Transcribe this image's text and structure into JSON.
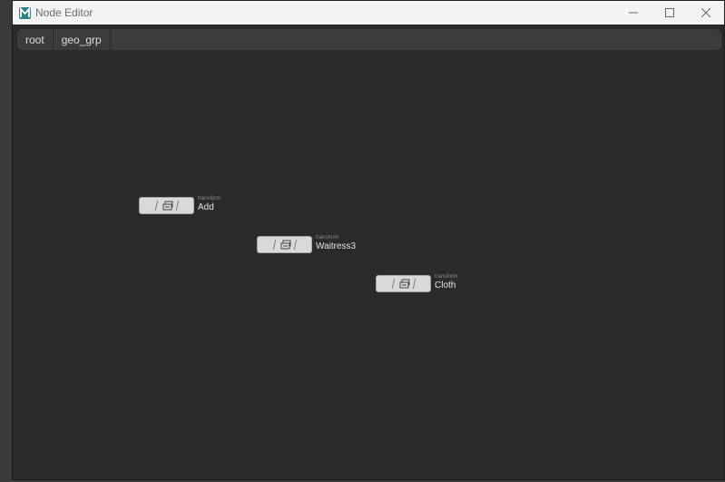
{
  "window": {
    "title": "Node Editor"
  },
  "window_controls": {
    "minimize": "—",
    "maximize": "☐",
    "close": "✕"
  },
  "breadcrumb": [
    "root",
    "geo_grp"
  ],
  "nodes": [
    {
      "type": "transform",
      "label": "Add"
    },
    {
      "type": "transform",
      "label": "Waitress3"
    },
    {
      "type": "transform",
      "label": "Cloth"
    }
  ],
  "colors": {
    "canvas": "#2b2b2b",
    "titlebar": "#f3f3f3",
    "logo_accent": "#2f7f86"
  }
}
